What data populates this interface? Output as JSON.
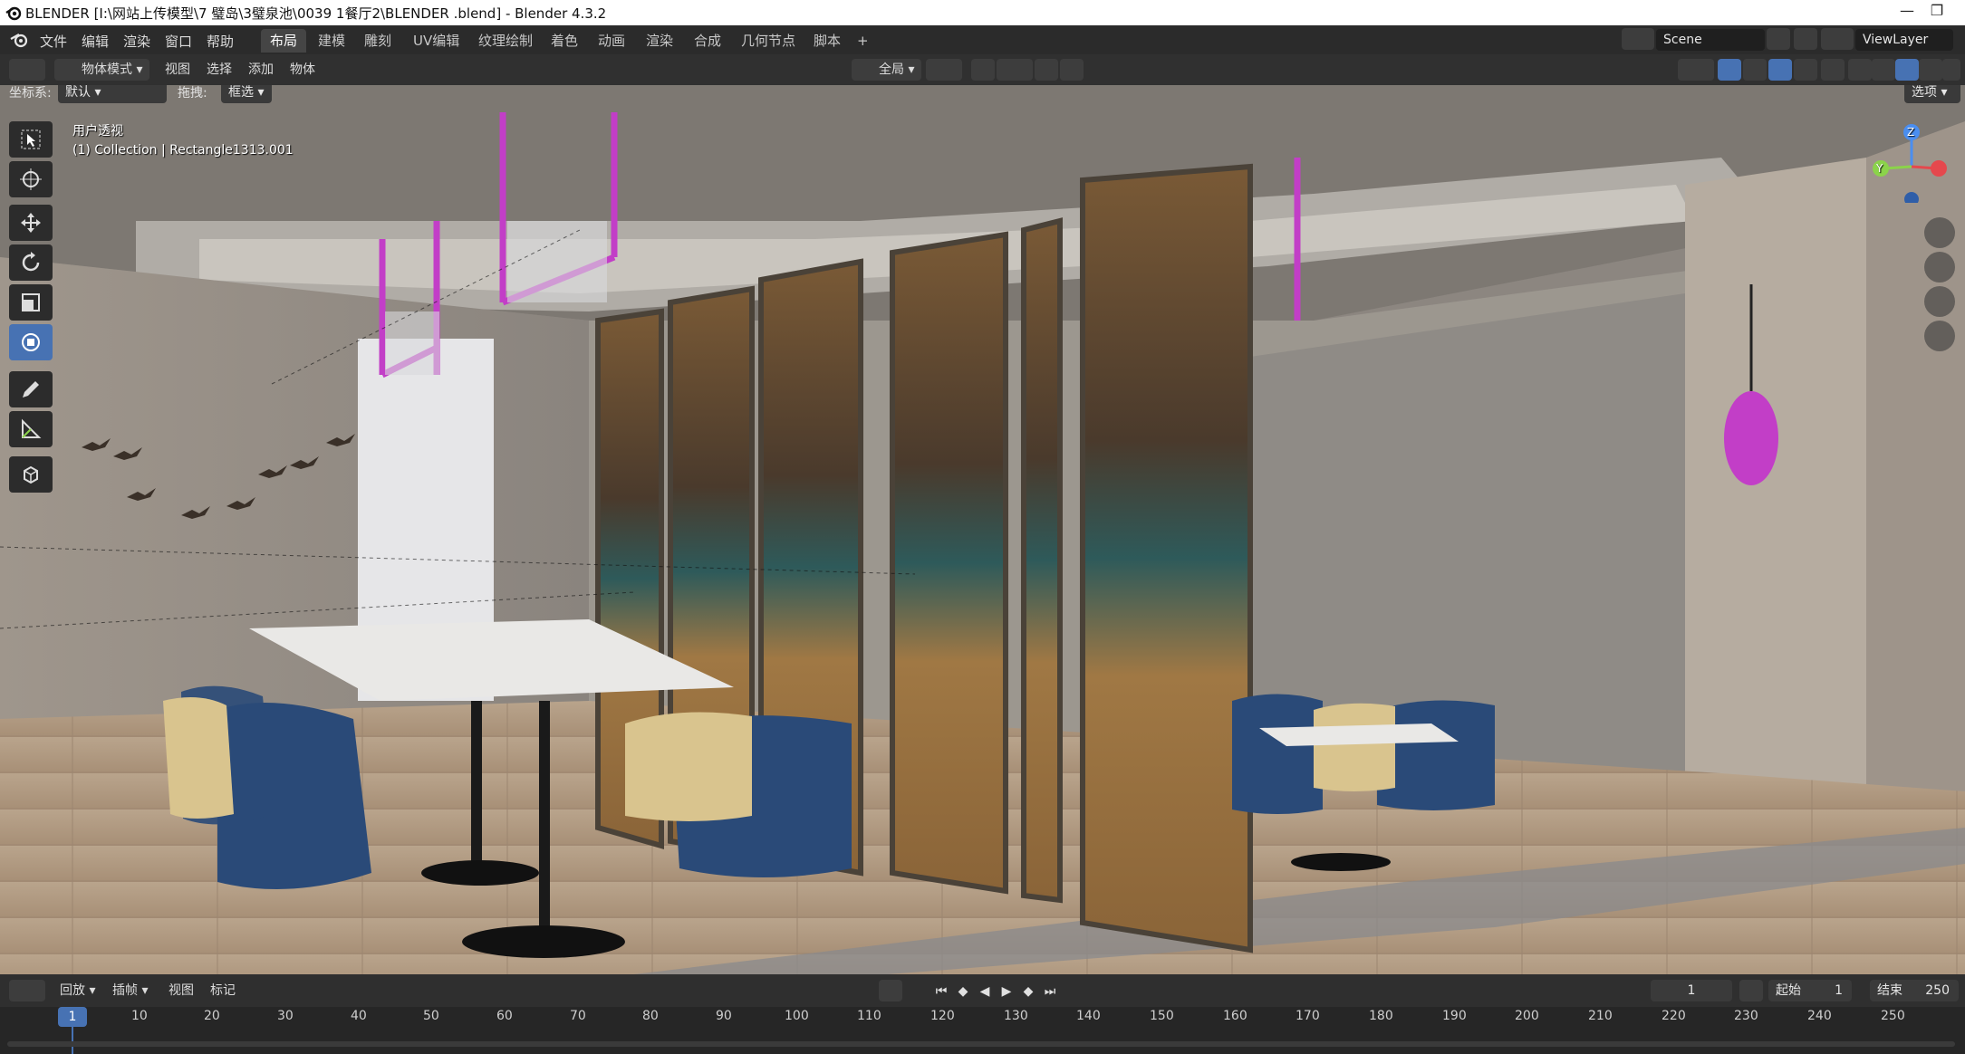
{
  "window": {
    "title": "BLENDER  [I:\\网站上传模型\\7 璧岛\\3璧泉池\\0039 1餐厅2\\BLENDER .blend] - Blender 4.3.2"
  },
  "menubar": {
    "items": [
      "文件",
      "编辑",
      "渲染",
      "窗口",
      "帮助"
    ],
    "workspaces": [
      "布局",
      "建模",
      "雕刻",
      "UV编辑",
      "纹理绘制",
      "着色",
      "动画",
      "渲染",
      "合成",
      "几何节点",
      "脚本"
    ],
    "active_workspace": "布局",
    "add_tab": "+",
    "scene": "Scene",
    "view_layer": "ViewLayer"
  },
  "header": {
    "mode": "物体模式",
    "menus": [
      "视图",
      "选择",
      "添加",
      "物体"
    ],
    "orientation_label": "全局",
    "coord_label": "坐标系:",
    "coord_value": "默认",
    "drag_label": "拖拽:",
    "drag_value": "框选",
    "options": "选项"
  },
  "viewport": {
    "view_name": "用户透视",
    "collection_info": "(1) Collection | Rectangle1313.001",
    "gizmo": {
      "z": "Z",
      "y": "Y",
      "x_color": "#e5484d",
      "y_color": "#8bd34a",
      "z_color": "#4a8ef0"
    }
  },
  "timeline": {
    "menus": [
      "回放",
      "插帧",
      "视图",
      "标记"
    ],
    "current_frame": "1",
    "start_label": "起始",
    "start_value": "1",
    "end_label": "结束",
    "end_value": "250",
    "ticks": [
      "10",
      "20",
      "30",
      "40",
      "50",
      "60",
      "70",
      "80",
      "90",
      "100",
      "110",
      "120",
      "130",
      "140",
      "150",
      "160",
      "170",
      "180",
      "190",
      "200",
      "210",
      "220",
      "230",
      "240",
      "250"
    ],
    "playhead": "1"
  },
  "colors": {
    "accent": "#4772b3",
    "header_bg": "#303030",
    "lamp_magenta": "#c23ec7",
    "chair_blue": "#2a4a78",
    "chair_cream": "#d9c48e"
  }
}
